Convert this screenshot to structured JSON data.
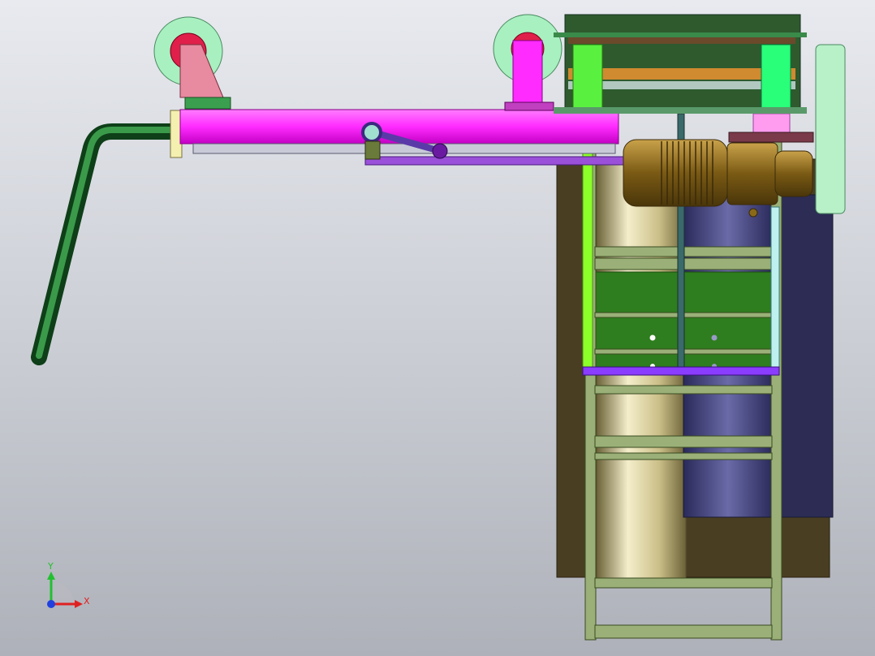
{
  "viewport": {
    "background_top": "#e8eaef",
    "background_bottom": "#aeb1b9"
  },
  "colors": {
    "beam_magenta": "#ff2bff",
    "pipe_green": "#1f6b2e",
    "wheel_mint": "#a8f0c0",
    "wheel_hub_red": "#e0204a",
    "bracket_pink": "#e88aa0",
    "frame_green": "#7aa060",
    "panel_green": "#2e7d1e",
    "motor_bronze": "#8a6a18",
    "tank_cream": "#e0d8a8",
    "tank_purple": "#4a4a80",
    "dark_base": "#4a3e22",
    "purple_bar": "#8a3cff",
    "lime_rod": "#8cff2a"
  },
  "triad": {
    "icon": "axis-triad-icon",
    "y_label": "Y",
    "x_label": "X",
    "y_color": "#22c030",
    "x_color": "#e02020",
    "z_color": "#2040e0"
  }
}
